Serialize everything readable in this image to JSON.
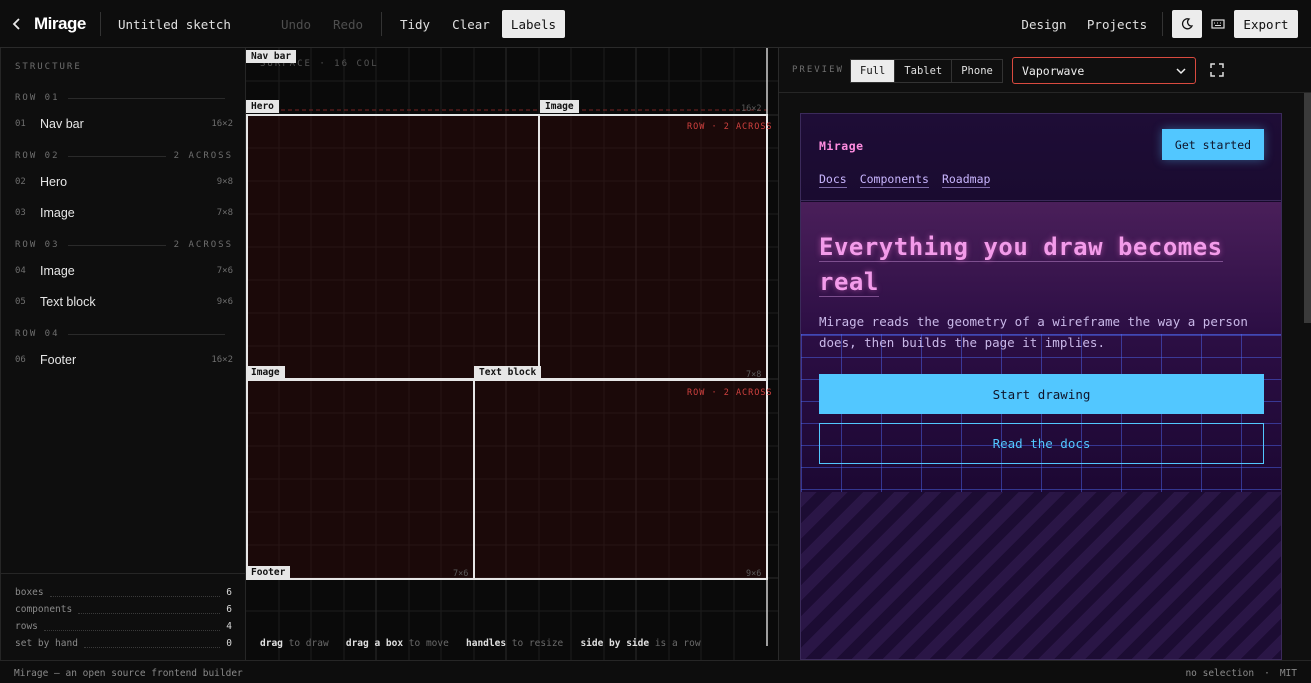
{
  "app": {
    "brand": "Mirage",
    "title": "Untitled sketch"
  },
  "toolbar": {
    "undo": "Undo",
    "redo": "Redo",
    "tidy": "Tidy",
    "clear": "Clear",
    "labels": "Labels",
    "design": "Design",
    "projects": "Projects",
    "export": "Export",
    "icons": [
      "back-chevron-icon",
      "theme-moon-icon",
      "keyboard-icon"
    ]
  },
  "structure": {
    "label": "STRUCTURE",
    "rows": [
      {
        "header": "ROW 01",
        "across": "",
        "items": [
          {
            "num": "01",
            "name": "Nav bar",
            "size": "16×2"
          }
        ]
      },
      {
        "header": "ROW 02",
        "across": "2 ACROSS",
        "items": [
          {
            "num": "02",
            "name": "Hero",
            "size": "9×8"
          },
          {
            "num": "03",
            "name": "Image",
            "size": "7×8"
          }
        ]
      },
      {
        "header": "ROW 03",
        "across": "2 ACROSS",
        "items": [
          {
            "num": "04",
            "name": "Image",
            "size": "7×6"
          },
          {
            "num": "05",
            "name": "Text block",
            "size": "9×6"
          }
        ]
      },
      {
        "header": "ROW 04",
        "across": "",
        "items": [
          {
            "num": "06",
            "name": "Footer",
            "size": "16×2"
          }
        ]
      }
    ],
    "stats": [
      {
        "label": "boxes",
        "value": "6"
      },
      {
        "label": "components",
        "value": "6"
      },
      {
        "label": "rows",
        "value": "4"
      },
      {
        "label": "set by hand",
        "value": "0"
      }
    ]
  },
  "canvas": {
    "surface_label": "SURFACE · 16 COL",
    "boxes": [
      {
        "tag": "Nav bar",
        "size": "16×2"
      },
      {
        "tag": "Hero",
        "size": ""
      },
      {
        "tag": "Image",
        "size": "7×8",
        "row_note": "ROW · 2 ACROSS"
      },
      {
        "tag": "Image",
        "size": "7×6"
      },
      {
        "tag": "Text block",
        "size": "9×6",
        "row_note": "ROW · 2 ACROSS"
      },
      {
        "tag": "Footer",
        "size": ""
      }
    ],
    "hints": [
      {
        "key": "drag",
        "text": "to draw"
      },
      {
        "key": "drag a box",
        "text": "to move"
      },
      {
        "key": "handles",
        "text": "to resize"
      },
      {
        "key": "side by side",
        "text": "is a row"
      }
    ]
  },
  "preview": {
    "label": "PREVIEW",
    "modes": [
      "Full",
      "Tablet",
      "Phone"
    ],
    "active_mode": "Full",
    "theme": "Vaporwave",
    "site": {
      "logo": "Mirage",
      "cta_nav": "Get started",
      "nav_links": [
        "Docs",
        "Components",
        "Roadmap"
      ],
      "headline_line1": "Everything you draw becomes",
      "headline_line2": "real",
      "lede": "Mirage reads the geometry of a wireframe the way a person does, then builds the page it implies.",
      "primary": "Start drawing",
      "secondary": "Read the docs"
    },
    "colors": {
      "accent": "#52c7ff",
      "headline": "#f39bea",
      "theme_border": "#d94a3f"
    }
  },
  "footer": {
    "left": "Mirage — an open source frontend builder",
    "selection": "no selection",
    "license": "MIT"
  }
}
